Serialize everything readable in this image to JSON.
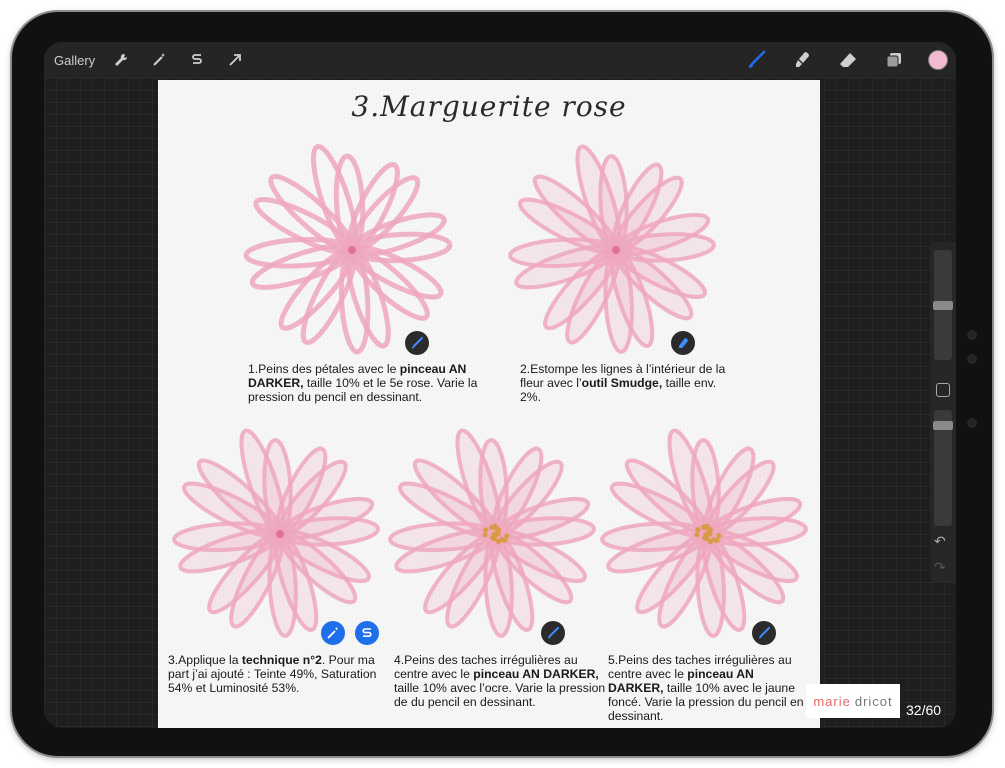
{
  "toolbar": {
    "gallery_label": "Gallery",
    "left_tools": [
      "wrench-icon",
      "magic-wand-icon",
      "selection-s-icon",
      "arrow-transform-icon"
    ],
    "right_tools": [
      "brush-icon",
      "smudge-icon",
      "eraser-icon",
      "layers-icon"
    ],
    "active_tool": "brush-icon",
    "active_color": "#f2b9d0",
    "accent_color": "#1f6feb"
  },
  "page": {
    "title": "3.Marguerite rose",
    "flower_color": "#eea7bd",
    "center_color": "#d99a4a",
    "steps": [
      {
        "n1": "1.Peins des pétales avec le ",
        "b1": "pinceau AN DARKER,",
        "n2": " taille 10% et le 5e rose. Varie la pression du pencil en dessinant.",
        "b2": "",
        "n3": "",
        "icon": "brush-icon"
      },
      {
        "n1": "2.Estompe les lignes à l’intérieur de la fleur avec l’",
        "b1": "outil Smudge,",
        "n2": " taille env. 2%.",
        "b2": "",
        "n3": "",
        "icon": "smudge-icon"
      },
      {
        "n1": "3.Applique la ",
        "b1": "technique n°2",
        "n2": ". Pour ma part j’ai ajouté : Teinte 49%, Saturation 54% et Luminosité 53%.",
        "b2": "",
        "n3": "",
        "icon": "adjustments-icon"
      },
      {
        "n1": "4.Peins des taches irrégulières au centre avec le ",
        "b1": "pinceau AN DARKER,",
        "n2": " taille 10% avec l’ocre. Varie la pression de du pencil en dessinant.",
        "b2": "",
        "n3": "",
        "icon": "brush-icon"
      },
      {
        "n1": "5.Peins des taches irrégulières au centre avec le ",
        "b1": "pinceau AN DARKER,",
        "n2": " taille 10% avec le jaune foncé. Varie la pression du pencil en dessinant.",
        "b2": "",
        "n3": "",
        "icon": "brush-icon"
      }
    ]
  },
  "sidebar": {
    "brush_size_fraction": 0.5,
    "opacity_fraction": 0.1
  },
  "logo": {
    "part1": "marie",
    "part2": "dricot"
  },
  "page_counter": "32/60"
}
